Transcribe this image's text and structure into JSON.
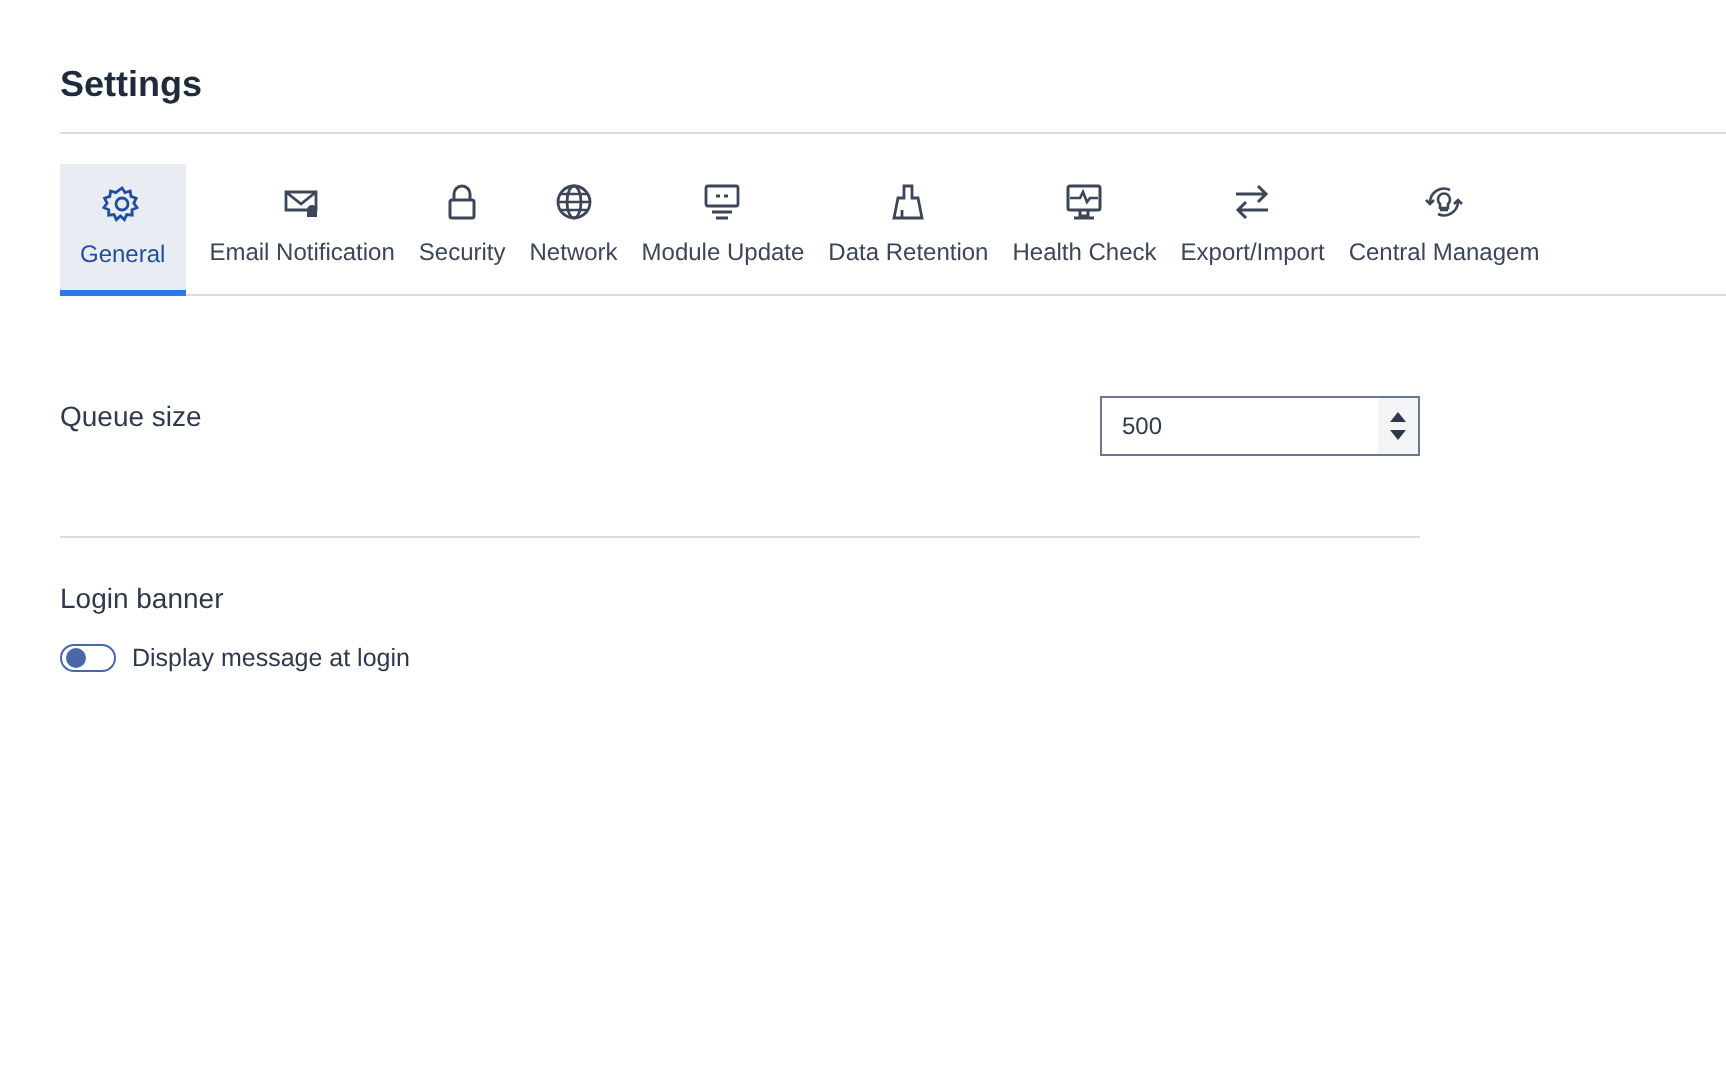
{
  "page_title": "Settings",
  "tabs": [
    {
      "label": "General",
      "kind": "gear",
      "selected": true
    },
    {
      "label": "Email Notification",
      "kind": "mail",
      "selected": false
    },
    {
      "label": "Security",
      "kind": "lock",
      "selected": false
    },
    {
      "label": "Network",
      "kind": "globe",
      "selected": false
    },
    {
      "label": "Module Update",
      "kind": "module",
      "selected": false
    },
    {
      "label": "Data Retention",
      "kind": "brush",
      "selected": false
    },
    {
      "label": "Health Check",
      "kind": "monitor",
      "selected": false
    },
    {
      "label": "Export/Import",
      "kind": "arrows",
      "selected": false
    },
    {
      "label": "Central Managem",
      "kind": "bulb",
      "selected": false
    }
  ],
  "queue_size": {
    "label": "Queue size",
    "value": "500"
  },
  "login_banner": {
    "heading": "Login banner",
    "toggle": {
      "label": "Display message at login",
      "on": false
    }
  }
}
